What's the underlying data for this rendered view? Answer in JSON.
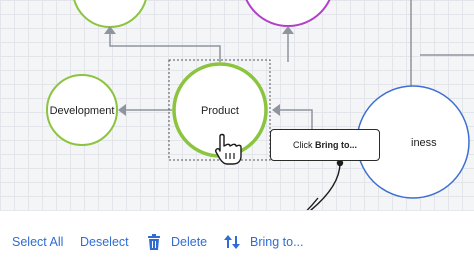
{
  "diagram": {
    "nodes": [
      {
        "name": "development-node",
        "label": "Development"
      },
      {
        "name": "product-node",
        "label": "Product"
      },
      {
        "name": "business-node",
        "label": "iness"
      }
    ]
  },
  "tooltip": {
    "prefix": "Click ",
    "action": "Bring to..."
  },
  "toolbar": {
    "select_all": "Select All",
    "deselect": "Deselect",
    "delete": "Delete",
    "bring_to": "Bring to..."
  },
  "colors": {
    "green": "#8cc43f",
    "purple": "#b23fc9",
    "blue": "#3c6fcf",
    "link_blue": "#2f6dd5",
    "connector_gray": "#8e959e"
  },
  "icons": [
    "hand-cursor-icon",
    "trash-icon",
    "sort-arrows-icon"
  ]
}
